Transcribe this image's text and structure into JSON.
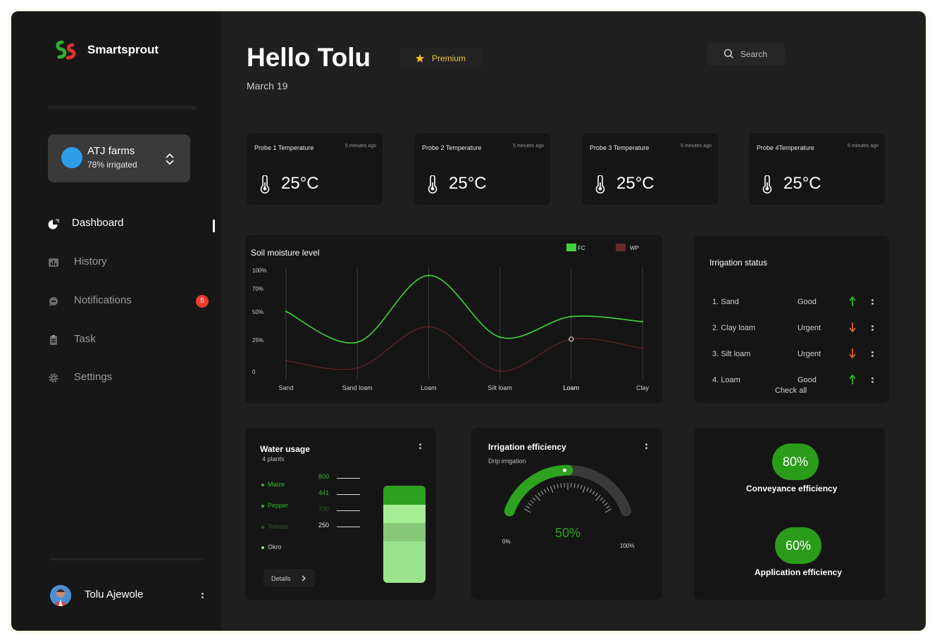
{
  "app": {
    "brand": "Smartsprout"
  },
  "farm": {
    "name": "ATJ farms",
    "status": "78% irrigated"
  },
  "nav": [
    {
      "label": "Dashboard",
      "icon": "pie-chart-icon",
      "active": true
    },
    {
      "label": "History",
      "icon": "bar-chart-icon"
    },
    {
      "label": "Notifications",
      "icon": "chat-bubble-icon",
      "badge": "5"
    },
    {
      "label": "Task",
      "icon": "clipboard-icon"
    },
    {
      "label": "Settings",
      "icon": "gear-icon"
    }
  ],
  "user": {
    "name": "Tolu Ajewole"
  },
  "header": {
    "greeting": "Hello Tolu",
    "date": "March 19",
    "premium_label": "Premium",
    "search_label": "Search"
  },
  "probes": [
    {
      "title": "Probe 1 Temperature",
      "time": "5 minutes ago",
      "value": "25°C"
    },
    {
      "title": "Probe 2 Temperature",
      "time": "5 minutes ago",
      "value": "25°C"
    },
    {
      "title": "Probe 3 Temperature",
      "time": "5 minutes ago",
      "value": "25°C"
    },
    {
      "title": "Probe 4Temperature",
      "time": "5 minutes ago",
      "value": "25°C"
    }
  ],
  "soil": {
    "title": "Soil moisture level",
    "chart_data": {
      "type": "line",
      "categories": [
        "Sand",
        "Sand loam",
        "Loam",
        "Silt loam",
        "Loam",
        "Clay"
      ],
      "y_ticks": [
        "100%",
        "70%",
        "50%",
        "25%",
        "0"
      ],
      "series": [
        {
          "name": "FC",
          "color": "#3fd33a",
          "values": [
            60,
            30,
            95,
            35,
            55,
            50
          ]
        },
        {
          "name": "WP",
          "color": "#6b2a26",
          "values": [
            12,
            5,
            45,
            2,
            33,
            24
          ]
        }
      ],
      "ylim": [
        0,
        100
      ],
      "legend": "top-right"
    }
  },
  "irrigation": {
    "title": "Irrigation status",
    "rows": [
      {
        "name": "1. Sand",
        "status": "Good",
        "trend": "up"
      },
      {
        "name": "2. Clay loam",
        "status": "Urgent",
        "trend": "down"
      },
      {
        "name": "3. Silt loam",
        "status": "Urgent",
        "trend": "down"
      },
      {
        "name": "4. Loam",
        "status": "Good",
        "trend": "up"
      }
    ],
    "check_all": "Check all",
    "colors": {
      "good": "#31c72a",
      "urgent": "#f06a2a"
    }
  },
  "water": {
    "title": "Water usage",
    "subtitle": "4 plants",
    "plants": [
      "Maize",
      "Pepper",
      "Tomato",
      "Okro"
    ],
    "ticks": [
      "800",
      "441",
      "700",
      "250"
    ],
    "details_label": "Details"
  },
  "efficiency": {
    "title": "Irrigation efficiency",
    "subtitle": "Drip irrigation",
    "value": "50%",
    "min_label": "0%",
    "max_label": "100%",
    "fraction": 0.5
  },
  "summary": {
    "conveyance_value": "80%",
    "conveyance_label": "Conveyance efficiency",
    "application_value": "60%",
    "application_label": "Application efficiency"
  }
}
